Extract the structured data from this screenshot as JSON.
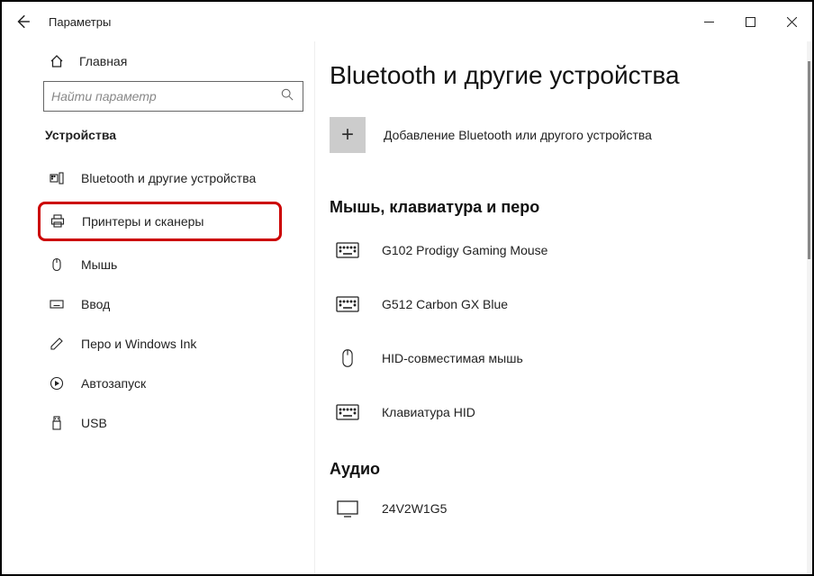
{
  "titlebar": {
    "title": "Параметры"
  },
  "sidebar": {
    "home": "Главная",
    "search_placeholder": "Найти параметр",
    "heading": "Устройства",
    "items": [
      {
        "label": "Bluetooth и другие устройства"
      },
      {
        "label": "Принтеры и сканеры"
      },
      {
        "label": "Мышь"
      },
      {
        "label": "Ввод"
      },
      {
        "label": "Перо и Windows Ink"
      },
      {
        "label": "Автозапуск"
      },
      {
        "label": "USB"
      }
    ]
  },
  "content": {
    "title": "Bluetooth и другие устройства",
    "add_label": "Добавление Bluetooth или другого устройства",
    "section1": "Мышь, клавиатура и перо",
    "devices": [
      {
        "name": "G102 Prodigy Gaming Mouse",
        "icon": "keyboard"
      },
      {
        "name": "G512 Carbon GX Blue",
        "icon": "keyboard"
      },
      {
        "name": "HID-совместимая мышь",
        "icon": "mouse"
      },
      {
        "name": "Клавиатура HID",
        "icon": "keyboard"
      }
    ],
    "section2": "Аудио",
    "audio_devices": [
      {
        "name": "24V2W1G5"
      }
    ]
  }
}
